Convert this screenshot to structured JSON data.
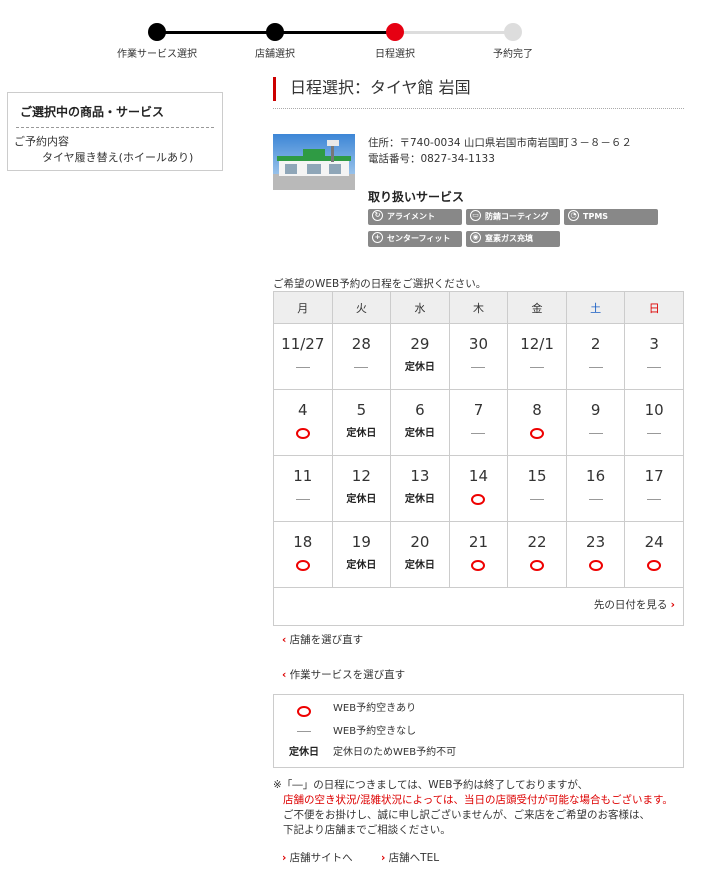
{
  "stepper": {
    "steps": [
      {
        "label": "作業サービス選択",
        "state": "done"
      },
      {
        "label": "店舗選択",
        "state": "done"
      },
      {
        "label": "日程選択",
        "state": "current"
      },
      {
        "label": "予約完了",
        "state": "todo"
      }
    ],
    "colors": {
      "done": "#000000",
      "current": "#e60012",
      "todo": "#dddddd"
    }
  },
  "sidebar": {
    "title": "ご選択中の商品・サービス",
    "subheading": "ご予約内容",
    "item": "タイヤ履き替え(ホイールあり)"
  },
  "header": {
    "title": "日程選択：タイヤ館 岩国"
  },
  "shop": {
    "address": "住所：〒740-0034 山口県岩国市南岩国町３－８－６２",
    "phone": "電話番号：0827-34-1133",
    "services_title": "取り扱いサービス",
    "services": [
      {
        "label": "アライメント",
        "icon": "refresh-icon"
      },
      {
        "label": "防錆コーティング",
        "icon": "car-icon"
      },
      {
        "label": "TPMS",
        "icon": "gauge-icon"
      },
      {
        "label": "センターフィット",
        "icon": "target-icon"
      },
      {
        "label": "窒素ガス充填",
        "icon": "gas-icon"
      }
    ]
  },
  "calendar": {
    "prompt": "ご希望のWEB予約の日程をご選択ください。",
    "weekdays": [
      "月",
      "火",
      "水",
      "木",
      "金",
      "土",
      "日"
    ],
    "weeks": [
      [
        {
          "date": "11/27",
          "status": "none"
        },
        {
          "date": "28",
          "status": "none"
        },
        {
          "date": "29",
          "status": "closed"
        },
        {
          "date": "30",
          "status": "none"
        },
        {
          "date": "12/1",
          "status": "none"
        },
        {
          "date": "2",
          "status": "none"
        },
        {
          "date": "3",
          "status": "none"
        }
      ],
      [
        {
          "date": "4",
          "status": "open"
        },
        {
          "date": "5",
          "status": "closed"
        },
        {
          "date": "6",
          "status": "closed"
        },
        {
          "date": "7",
          "status": "none"
        },
        {
          "date": "8",
          "status": "open"
        },
        {
          "date": "9",
          "status": "none"
        },
        {
          "date": "10",
          "status": "none"
        }
      ],
      [
        {
          "date": "11",
          "status": "none"
        },
        {
          "date": "12",
          "status": "closed"
        },
        {
          "date": "13",
          "status": "closed"
        },
        {
          "date": "14",
          "status": "open"
        },
        {
          "date": "15",
          "status": "none"
        },
        {
          "date": "16",
          "status": "none"
        },
        {
          "date": "17",
          "status": "none"
        }
      ],
      [
        {
          "date": "18",
          "status": "open"
        },
        {
          "date": "19",
          "status": "closed"
        },
        {
          "date": "20",
          "status": "closed"
        },
        {
          "date": "21",
          "status": "open"
        },
        {
          "date": "22",
          "status": "open"
        },
        {
          "date": "23",
          "status": "open"
        },
        {
          "date": "24",
          "status": "open"
        }
      ]
    ],
    "closed_label": "定休日",
    "next_label": "先の日付を見る",
    "colors": {
      "saturday": "#1a5fc4",
      "sunday": "#dd0000",
      "open": "#e60012"
    }
  },
  "links": {
    "reselect_store": "店舗を選び直す",
    "reselect_service": "作業サービスを選び直す",
    "store_site": "店舗サイトへ",
    "store_tel": "店舗へTEL"
  },
  "legend": [
    {
      "symbol": "open",
      "text": "WEB予約空きあり"
    },
    {
      "symbol": "none",
      "text": "WEB予約空きなし"
    },
    {
      "symbol": "定休日",
      "text": "定休日のためWEB予約不可"
    }
  ],
  "note": {
    "line1": "※「―」の日程につきましては、WEB予約は終了しておりますが、",
    "line2": "店舗の空き状況/混雑状況によっては、当日の店頭受付が可能な場合もございます。",
    "line3": "ご不便をお掛けし、誠に申し訳ございませんが、ご来店をご希望のお客様は、",
    "line4": "下記より店舗までご相談ください。"
  }
}
